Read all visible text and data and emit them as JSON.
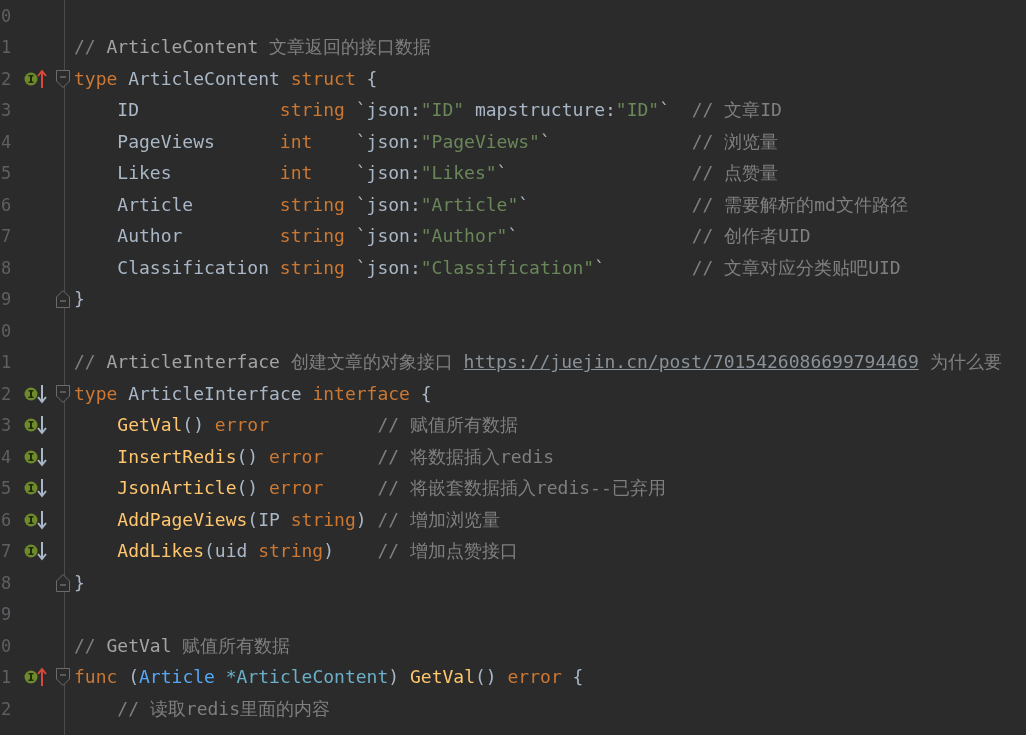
{
  "editor": {
    "lines": [
      {
        "number": "0"
      },
      {
        "number": "1",
        "indented": false,
        "tokens": [
          {
            "kind": "comment",
            "text": "// "
          },
          {
            "kind": "comment-ref",
            "text": "ArticleContent"
          },
          {
            "kind": "comment",
            "text": " 文章返回的接口数据"
          }
        ]
      },
      {
        "number": "2",
        "indented": false,
        "marker": {
          "kind": "up"
        },
        "fold": {
          "kind": "start"
        },
        "tokens": [
          {
            "kind": "keyword",
            "text": "type "
          },
          {
            "kind": "plain",
            "text": "ArticleContent "
          },
          {
            "kind": "keyword",
            "text": "struct "
          },
          {
            "kind": "plain",
            "text": "{"
          }
        ]
      },
      {
        "number": "3",
        "indented": true,
        "tokens": [
          {
            "kind": "plain",
            "text": "ID             "
          },
          {
            "kind": "keyword",
            "text": "string "
          },
          {
            "kind": "plain",
            "text": "`json:"
          },
          {
            "kind": "string",
            "text": "\"ID\""
          },
          {
            "kind": "plain",
            "text": " mapstructure:"
          },
          {
            "kind": "string",
            "text": "\"ID\""
          },
          {
            "kind": "plain",
            "text": "`  "
          },
          {
            "kind": "comment",
            "text": "// 文章ID"
          }
        ]
      },
      {
        "number": "4",
        "indented": true,
        "tokens": [
          {
            "kind": "plain",
            "text": "PageViews      "
          },
          {
            "kind": "keyword",
            "text": "int    "
          },
          {
            "kind": "plain",
            "text": "`json:"
          },
          {
            "kind": "string",
            "text": "\"PageViews\""
          },
          {
            "kind": "plain",
            "text": "`             "
          },
          {
            "kind": "comment",
            "text": "// 浏览量"
          }
        ]
      },
      {
        "number": "5",
        "indented": true,
        "tokens": [
          {
            "kind": "plain",
            "text": "Likes          "
          },
          {
            "kind": "keyword",
            "text": "int    "
          },
          {
            "kind": "plain",
            "text": "`json:"
          },
          {
            "kind": "string",
            "text": "\"Likes\""
          },
          {
            "kind": "plain",
            "text": "`                 "
          },
          {
            "kind": "comment",
            "text": "// 点赞量"
          }
        ]
      },
      {
        "number": "6",
        "indented": true,
        "tokens": [
          {
            "kind": "plain",
            "text": "Article        "
          },
          {
            "kind": "keyword",
            "text": "string "
          },
          {
            "kind": "plain",
            "text": "`json:"
          },
          {
            "kind": "string",
            "text": "\"Article\""
          },
          {
            "kind": "plain",
            "text": "`               "
          },
          {
            "kind": "comment",
            "text": "// 需要解析的md文件路径"
          }
        ]
      },
      {
        "number": "7",
        "indented": true,
        "tokens": [
          {
            "kind": "plain",
            "text": "Author         "
          },
          {
            "kind": "keyword",
            "text": "string "
          },
          {
            "kind": "plain",
            "text": "`json:"
          },
          {
            "kind": "string",
            "text": "\"Author\""
          },
          {
            "kind": "plain",
            "text": "`                "
          },
          {
            "kind": "comment",
            "text": "// 创作者UID"
          }
        ]
      },
      {
        "number": "8",
        "indented": true,
        "tokens": [
          {
            "kind": "plain",
            "text": "Classification "
          },
          {
            "kind": "keyword",
            "text": "string "
          },
          {
            "kind": "plain",
            "text": "`json:"
          },
          {
            "kind": "string",
            "text": "\"Classification\""
          },
          {
            "kind": "plain",
            "text": "`        "
          },
          {
            "kind": "comment",
            "text": "// 文章对应分类贴吧UID"
          }
        ]
      },
      {
        "number": "9",
        "indented": false,
        "fold": {
          "kind": "end"
        },
        "tokens": [
          {
            "kind": "plain",
            "text": "}"
          }
        ]
      },
      {
        "number": "0"
      },
      {
        "number": "1",
        "indented": false,
        "tokens": [
          {
            "kind": "comment",
            "text": "// "
          },
          {
            "kind": "comment-ref",
            "text": "ArticleInterface"
          },
          {
            "kind": "comment",
            "text": " 创建文章的对象接口 "
          },
          {
            "kind": "link",
            "text": "https://juejin.cn/post/7015426086699794469"
          },
          {
            "kind": "comment",
            "text": " 为什么要"
          }
        ]
      },
      {
        "number": "2",
        "indented": false,
        "marker": {
          "kind": "down"
        },
        "fold": {
          "kind": "start"
        },
        "tokens": [
          {
            "kind": "keyword",
            "text": "type "
          },
          {
            "kind": "plain",
            "text": "ArticleInterface "
          },
          {
            "kind": "keyword",
            "text": "interface "
          },
          {
            "kind": "plain",
            "text": "{"
          }
        ]
      },
      {
        "number": "3",
        "indented": true,
        "marker": {
          "kind": "down"
        },
        "tokens": [
          {
            "kind": "function",
            "text": "GetVal"
          },
          {
            "kind": "plain",
            "text": "() "
          },
          {
            "kind": "keyword",
            "text": "error          "
          },
          {
            "kind": "comment",
            "text": "// 赋值所有数据"
          }
        ]
      },
      {
        "number": "4",
        "indented": true,
        "marker": {
          "kind": "down"
        },
        "tokens": [
          {
            "kind": "function",
            "text": "InsertRedis"
          },
          {
            "kind": "plain",
            "text": "() "
          },
          {
            "kind": "keyword",
            "text": "error     "
          },
          {
            "kind": "comment",
            "text": "// 将数据插入redis"
          }
        ]
      },
      {
        "number": "5",
        "indented": true,
        "marker": {
          "kind": "down"
        },
        "tokens": [
          {
            "kind": "function",
            "text": "JsonArticle"
          },
          {
            "kind": "plain",
            "text": "() "
          },
          {
            "kind": "keyword",
            "text": "error     "
          },
          {
            "kind": "comment",
            "text": "// 将嵌套数据插入redis--已弃用"
          }
        ]
      },
      {
        "number": "6",
        "indented": true,
        "marker": {
          "kind": "down"
        },
        "tokens": [
          {
            "kind": "function",
            "text": "AddPageViews"
          },
          {
            "kind": "plain",
            "text": "(IP "
          },
          {
            "kind": "keyword",
            "text": "string"
          },
          {
            "kind": "plain",
            "text": ") "
          },
          {
            "kind": "comment",
            "text": "// 增加浏览量"
          }
        ]
      },
      {
        "number": "7",
        "indented": true,
        "marker": {
          "kind": "down"
        },
        "tokens": [
          {
            "kind": "function",
            "text": "AddLikes"
          },
          {
            "kind": "plain",
            "text": "(uid "
          },
          {
            "kind": "keyword",
            "text": "string"
          },
          {
            "kind": "plain",
            "text": ")    "
          },
          {
            "kind": "comment",
            "text": "// 增加点赞接口"
          }
        ]
      },
      {
        "number": "8",
        "indented": false,
        "fold": {
          "kind": "end"
        },
        "tokens": [
          {
            "kind": "plain",
            "text": "}"
          }
        ]
      },
      {
        "number": "9"
      },
      {
        "number": "0",
        "indented": false,
        "tokens": [
          {
            "kind": "comment",
            "text": "// "
          },
          {
            "kind": "comment-ref",
            "text": "GetVal"
          },
          {
            "kind": "comment",
            "text": " 赋值所有数据"
          }
        ]
      },
      {
        "number": "1",
        "indented": false,
        "marker": {
          "kind": "up"
        },
        "fold": {
          "kind": "start"
        },
        "tokens": [
          {
            "kind": "keyword",
            "text": "func "
          },
          {
            "kind": "plain",
            "text": "("
          },
          {
            "kind": "receiver",
            "text": "Article "
          },
          {
            "kind": "receiver-type",
            "text": "*ArticleContent"
          },
          {
            "kind": "plain",
            "text": ") "
          },
          {
            "kind": "function",
            "text": "GetVal"
          },
          {
            "kind": "plain",
            "text": "() "
          },
          {
            "kind": "keyword",
            "text": "error "
          },
          {
            "kind": "plain",
            "text": "{"
          }
        ]
      },
      {
        "number": "2",
        "indented": true,
        "tokens": [
          {
            "kind": "comment",
            "text": "// 读取redis里面的内容"
          }
        ]
      }
    ]
  }
}
